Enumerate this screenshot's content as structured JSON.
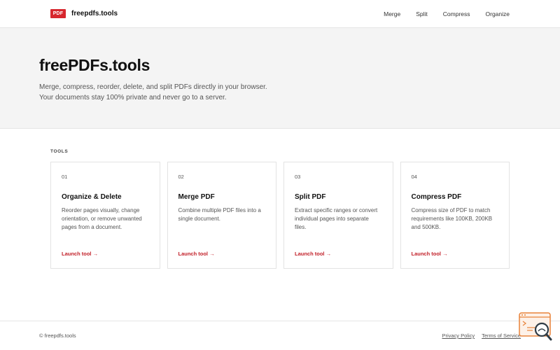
{
  "header": {
    "logo_badge": "PDF",
    "brand": "freepdfs.tools",
    "nav": [
      "Merge",
      "Split",
      "Compress",
      "Organize"
    ]
  },
  "hero": {
    "title": "freePDFs.tools",
    "line1": "Merge, compress, reorder, delete, and split PDFs directly in your browser.",
    "line2": "Your documents stay 100% private and never go to a server."
  },
  "tools": {
    "label": "TOOLS",
    "cards": [
      {
        "num": "01",
        "title": "Organize & Delete",
        "desc": "Reorder pages visually, change orientation, or remove unwanted pages from a document.",
        "link": "Launch tool →"
      },
      {
        "num": "02",
        "title": "Merge PDF",
        "desc": "Combine multiple PDF files into a single document.",
        "link": "Launch tool →"
      },
      {
        "num": "03",
        "title": "Split PDF",
        "desc": "Extract specific ranges or convert individual pages into separate files.",
        "link": "Launch tool →"
      },
      {
        "num": "04",
        "title": "Compress PDF",
        "desc": "Compress size of PDF to match requirements like 100KB, 200KB and 500KB.",
        "link": "Launch tool →"
      }
    ]
  },
  "footer": {
    "copyright": "© freepdfs.tools",
    "links": [
      "Privacy Policy",
      "Terms of Service"
    ]
  },
  "colors": {
    "brand_red": "#d7262d",
    "link_red": "#c22029",
    "hero_bg": "#f4f4f4",
    "fab_accent": "#e8833a"
  },
  "icons": {
    "floating_widget": "search-console-icon"
  }
}
